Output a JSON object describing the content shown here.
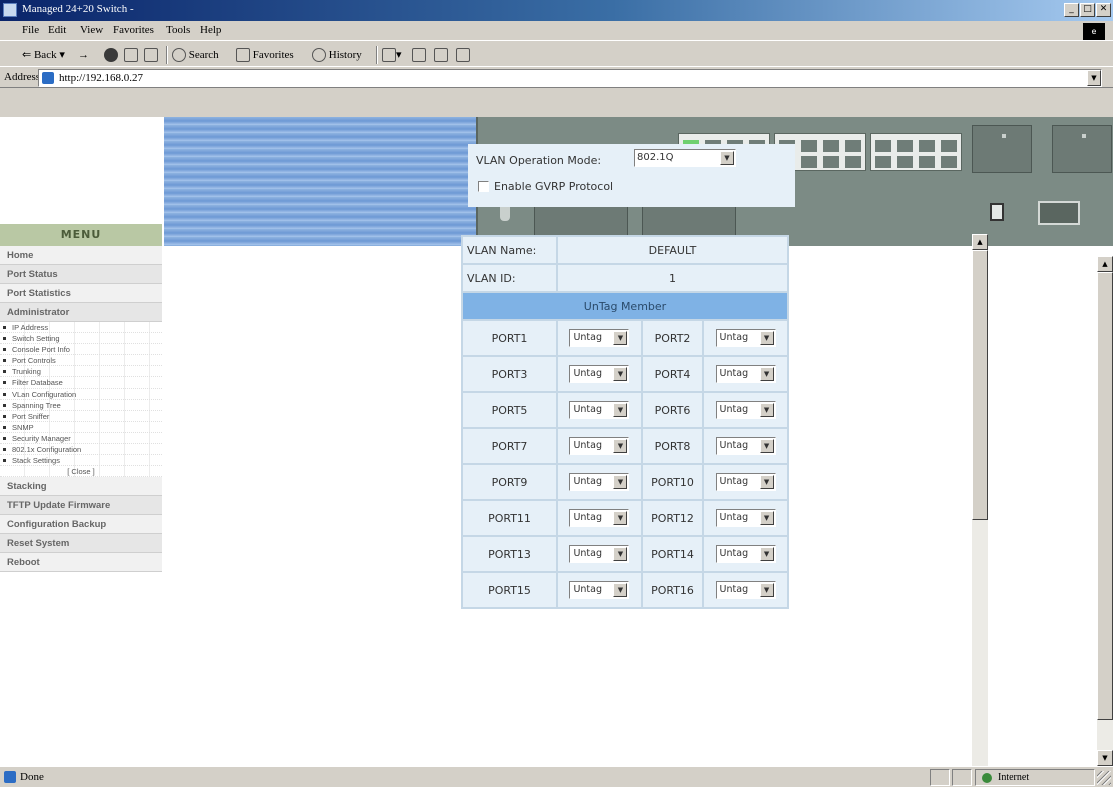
{
  "window": {
    "title": "Managed 24+20 Switch -",
    "min": "_",
    "max": "□",
    "close": "✕"
  },
  "menubar": [
    "File",
    "Edit",
    "View",
    "Favorites",
    "Tools",
    "Help"
  ],
  "toolbar": {
    "back": "Back",
    "forward": "→",
    "search": "Search",
    "favorites": "Favorites",
    "history": "History"
  },
  "address": {
    "label": "Address",
    "url": "http://192.168.0.27"
  },
  "sidemenu": {
    "title": "MENU",
    "items": [
      "Home",
      "Port Status",
      "Port Statistics",
      "Administrator"
    ],
    "subitems": [
      "IP Address",
      "Switch Setting",
      "Console Port Info",
      "Port Controls",
      "Trunking",
      "Filter Database",
      "VLan Configuration",
      "Spanning Tree",
      "Port Sniffer",
      "SNMP",
      "Security Manager",
      "802.1x Configuration",
      "Stack Settings",
      "[ Close ]"
    ],
    "items2": [
      "Stacking",
      "TFTP Update Firmware",
      "Configuration Backup",
      "Reset System",
      "Reboot"
    ]
  },
  "vlan_mode": {
    "label": "VLAN Operation Mode:",
    "value": "802.1Q",
    "gvrp_label": "Enable GVRP Protocol",
    "gvrp_checked": false
  },
  "vlan": {
    "name_label": "VLAN Name:",
    "name": "DEFAULT",
    "id_label": "VLAN ID:",
    "id": "1",
    "member_header": "UnTag Member",
    "ports": [
      [
        "PORT1",
        "PORT2"
      ],
      [
        "PORT3",
        "PORT4"
      ],
      [
        "PORT5",
        "PORT6"
      ],
      [
        "PORT7",
        "PORT8"
      ],
      [
        "PORT9",
        "PORT10"
      ],
      [
        "PORT11",
        "PORT12"
      ],
      [
        "PORT13",
        "PORT14"
      ],
      [
        "PORT15",
        "PORT16"
      ]
    ],
    "untag_value": "Untag"
  },
  "status": {
    "text": "Done",
    "zone": "Internet"
  },
  "colors": {
    "accent": "#7fb2e5",
    "panel": "#e6f0f8",
    "banner": "#8fb3e0"
  }
}
